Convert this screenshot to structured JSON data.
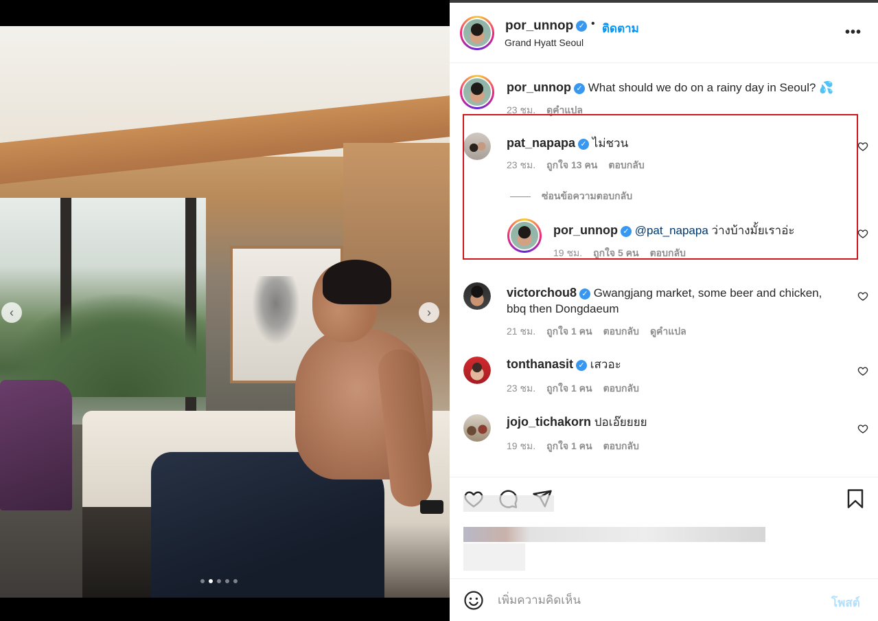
{
  "post": {
    "author": "por_unnop",
    "follow_label": "ติดตาม",
    "separator": "•",
    "location": "Grand Hyatt Seoul",
    "more_icon": "more-horizontal-icon",
    "carousel": {
      "prev_icon": "chevron-left-icon",
      "next_icon": "chevron-right-icon",
      "prev_glyph": "‹",
      "next_glyph": "›",
      "total_slides": 5,
      "active_slide": 2
    }
  },
  "comments": [
    {
      "user": "por_unnop",
      "verified": true,
      "text": "What should we do on a rainy day in Seoul? 💦",
      "time": "23 ชม.",
      "translate": "ดูคำแปล"
    },
    {
      "user": "pat_napapa",
      "verified": true,
      "text": "ไม่ชวน",
      "time": "23 ชม.",
      "likes": "ถูกใจ 13 คน",
      "reply": "ตอบกลับ",
      "hide_replies": "ซ่อนข้อความตอบกลับ",
      "replies": [
        {
          "user": "por_unnop",
          "verified": true,
          "mention": "@pat_napapa",
          "text": "ว่างบ้างมั้ยเราอ่ะ",
          "time": "19 ชม.",
          "likes": "ถูกใจ 5 คน",
          "reply": "ตอบกลับ"
        }
      ]
    },
    {
      "user": "victorchou8",
      "verified": true,
      "text": "Gwangjang market, some beer and chicken, bbq then Dongdaeum",
      "time": "21 ชม.",
      "likes": "ถูกใจ 1 คน",
      "reply": "ตอบกลับ",
      "translate": "ดูคำแปล"
    },
    {
      "user": "tonthanasit",
      "verified": true,
      "text": "เสวอะ",
      "time": "23 ชม.",
      "likes": "ถูกใจ 1 คน",
      "reply": "ตอบกลับ"
    },
    {
      "user": "jojo_tichakorn",
      "verified": false,
      "text": "ปอเอ๊ยยยย",
      "time": "19 ชม.",
      "likes": "ถูกใจ 1 คน",
      "reply": "ตอบกลับ"
    }
  ],
  "composer": {
    "placeholder": "เพิ่มความคิดเห็น",
    "post_label": "โพสต์"
  },
  "colors": {
    "accent": "#0095f6",
    "highlight_box": "#d0141b",
    "verified": "#3897f0"
  }
}
